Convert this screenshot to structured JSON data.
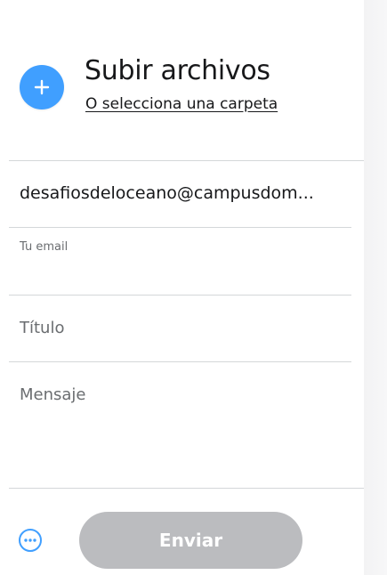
{
  "upload": {
    "title": "Subir archivos",
    "select_folder": "O selecciona una carpeta",
    "add_icon": "plus-icon"
  },
  "form": {
    "email_value": "desafiosdeloceano@campusdom...",
    "email_label": "Tu email",
    "title_placeholder": "Título",
    "message_placeholder": "Mensaje"
  },
  "footer": {
    "more_icon": "ellipsis-circle-icon",
    "send_label": "Enviar"
  },
  "colors": {
    "accent": "#409fff",
    "send_disabled": "#bbbcbf"
  }
}
